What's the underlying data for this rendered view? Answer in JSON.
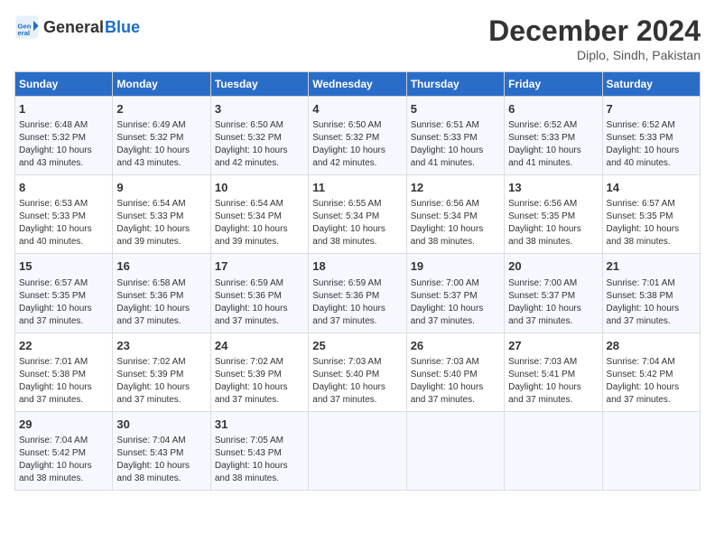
{
  "header": {
    "logo_line1": "General",
    "logo_line2": "Blue",
    "month_year": "December 2024",
    "location": "Diplo, Sindh, Pakistan"
  },
  "days_of_week": [
    "Sunday",
    "Monday",
    "Tuesday",
    "Wednesday",
    "Thursday",
    "Friday",
    "Saturday"
  ],
  "weeks": [
    [
      {
        "day": "1",
        "info": "Sunrise: 6:48 AM\nSunset: 5:32 PM\nDaylight: 10 hours\nand 43 minutes."
      },
      {
        "day": "2",
        "info": "Sunrise: 6:49 AM\nSunset: 5:32 PM\nDaylight: 10 hours\nand 43 minutes."
      },
      {
        "day": "3",
        "info": "Sunrise: 6:50 AM\nSunset: 5:32 PM\nDaylight: 10 hours\nand 42 minutes."
      },
      {
        "day": "4",
        "info": "Sunrise: 6:50 AM\nSunset: 5:32 PM\nDaylight: 10 hours\nand 42 minutes."
      },
      {
        "day": "5",
        "info": "Sunrise: 6:51 AM\nSunset: 5:33 PM\nDaylight: 10 hours\nand 41 minutes."
      },
      {
        "day": "6",
        "info": "Sunrise: 6:52 AM\nSunset: 5:33 PM\nDaylight: 10 hours\nand 41 minutes."
      },
      {
        "day": "7",
        "info": "Sunrise: 6:52 AM\nSunset: 5:33 PM\nDaylight: 10 hours\nand 40 minutes."
      }
    ],
    [
      {
        "day": "8",
        "info": "Sunrise: 6:53 AM\nSunset: 5:33 PM\nDaylight: 10 hours\nand 40 minutes."
      },
      {
        "day": "9",
        "info": "Sunrise: 6:54 AM\nSunset: 5:33 PM\nDaylight: 10 hours\nand 39 minutes."
      },
      {
        "day": "10",
        "info": "Sunrise: 6:54 AM\nSunset: 5:34 PM\nDaylight: 10 hours\nand 39 minutes."
      },
      {
        "day": "11",
        "info": "Sunrise: 6:55 AM\nSunset: 5:34 PM\nDaylight: 10 hours\nand 38 minutes."
      },
      {
        "day": "12",
        "info": "Sunrise: 6:56 AM\nSunset: 5:34 PM\nDaylight: 10 hours\nand 38 minutes."
      },
      {
        "day": "13",
        "info": "Sunrise: 6:56 AM\nSunset: 5:35 PM\nDaylight: 10 hours\nand 38 minutes."
      },
      {
        "day": "14",
        "info": "Sunrise: 6:57 AM\nSunset: 5:35 PM\nDaylight: 10 hours\nand 38 minutes."
      }
    ],
    [
      {
        "day": "15",
        "info": "Sunrise: 6:57 AM\nSunset: 5:35 PM\nDaylight: 10 hours\nand 37 minutes."
      },
      {
        "day": "16",
        "info": "Sunrise: 6:58 AM\nSunset: 5:36 PM\nDaylight: 10 hours\nand 37 minutes."
      },
      {
        "day": "17",
        "info": "Sunrise: 6:59 AM\nSunset: 5:36 PM\nDaylight: 10 hours\nand 37 minutes."
      },
      {
        "day": "18",
        "info": "Sunrise: 6:59 AM\nSunset: 5:36 PM\nDaylight: 10 hours\nand 37 minutes."
      },
      {
        "day": "19",
        "info": "Sunrise: 7:00 AM\nSunset: 5:37 PM\nDaylight: 10 hours\nand 37 minutes."
      },
      {
        "day": "20",
        "info": "Sunrise: 7:00 AM\nSunset: 5:37 PM\nDaylight: 10 hours\nand 37 minutes."
      },
      {
        "day": "21",
        "info": "Sunrise: 7:01 AM\nSunset: 5:38 PM\nDaylight: 10 hours\nand 37 minutes."
      }
    ],
    [
      {
        "day": "22",
        "info": "Sunrise: 7:01 AM\nSunset: 5:38 PM\nDaylight: 10 hours\nand 37 minutes."
      },
      {
        "day": "23",
        "info": "Sunrise: 7:02 AM\nSunset: 5:39 PM\nDaylight: 10 hours\nand 37 minutes."
      },
      {
        "day": "24",
        "info": "Sunrise: 7:02 AM\nSunset: 5:39 PM\nDaylight: 10 hours\nand 37 minutes."
      },
      {
        "day": "25",
        "info": "Sunrise: 7:03 AM\nSunset: 5:40 PM\nDaylight: 10 hours\nand 37 minutes."
      },
      {
        "day": "26",
        "info": "Sunrise: 7:03 AM\nSunset: 5:40 PM\nDaylight: 10 hours\nand 37 minutes."
      },
      {
        "day": "27",
        "info": "Sunrise: 7:03 AM\nSunset: 5:41 PM\nDaylight: 10 hours\nand 37 minutes."
      },
      {
        "day": "28",
        "info": "Sunrise: 7:04 AM\nSunset: 5:42 PM\nDaylight: 10 hours\nand 37 minutes."
      }
    ],
    [
      {
        "day": "29",
        "info": "Sunrise: 7:04 AM\nSunset: 5:42 PM\nDaylight: 10 hours\nand 38 minutes."
      },
      {
        "day": "30",
        "info": "Sunrise: 7:04 AM\nSunset: 5:43 PM\nDaylight: 10 hours\nand 38 minutes."
      },
      {
        "day": "31",
        "info": "Sunrise: 7:05 AM\nSunset: 5:43 PM\nDaylight: 10 hours\nand 38 minutes."
      },
      {
        "day": "",
        "info": ""
      },
      {
        "day": "",
        "info": ""
      },
      {
        "day": "",
        "info": ""
      },
      {
        "day": "",
        "info": ""
      }
    ]
  ]
}
